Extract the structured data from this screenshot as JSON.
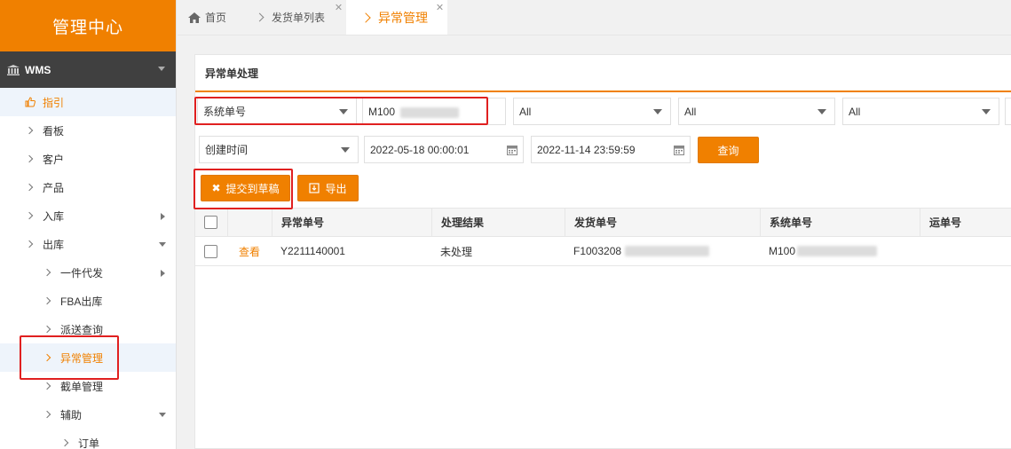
{
  "sidebar": {
    "brand": "管理中心",
    "section": "WMS",
    "items": [
      {
        "label": "指引"
      },
      {
        "label": "看板"
      },
      {
        "label": "客户"
      },
      {
        "label": "产品"
      },
      {
        "label": "入库"
      },
      {
        "label": "出库"
      },
      {
        "label": "一件代发"
      },
      {
        "label": "FBA出库"
      },
      {
        "label": "派送查询"
      },
      {
        "label": "异常管理"
      },
      {
        "label": "截单管理"
      },
      {
        "label": "辅助"
      },
      {
        "label": "订单"
      }
    ]
  },
  "tabs": [
    {
      "label": "首页"
    },
    {
      "label": "发货单列表"
    },
    {
      "label": "异常管理"
    }
  ],
  "panel": {
    "title": "异常单处理",
    "filters": {
      "field_select": "系统单号",
      "field_value": "M100",
      "select_a": "All",
      "select_b": "All",
      "select_c": "All",
      "time_select": "创建时间",
      "start_time": "2022-05-18 00:00:01",
      "end_time": "2022-11-14 23:59:59",
      "query_label": "查询"
    },
    "actions": {
      "submit_draft": "提交到草稿",
      "export": "导出"
    },
    "table": {
      "headers": [
        "异常单号",
        "处理结果",
        "发货单号",
        "系统单号",
        "运单号"
      ],
      "rows": [
        {
          "action": "查看",
          "exception_no": "Y2211140001",
          "result": "未处理",
          "ship_no": "F1003208",
          "system_no": "M100",
          "waybill": ""
        }
      ]
    }
  },
  "colors": {
    "accent": "#f08000",
    "highlight": "#e02020",
    "sidebar_dark": "#404040"
  }
}
